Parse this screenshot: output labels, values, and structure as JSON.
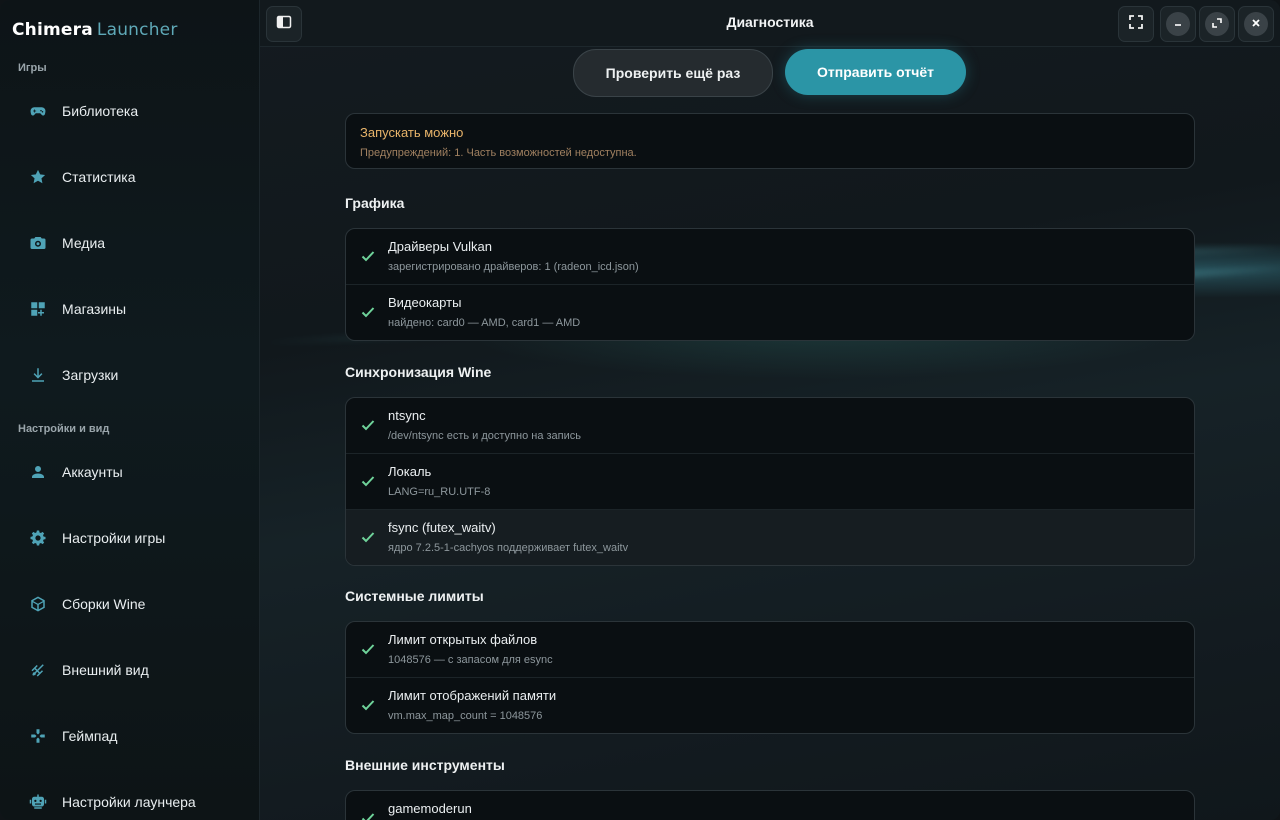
{
  "app": {
    "name_bold": "Chimera",
    "name_light": "Launcher"
  },
  "sidebar": {
    "section_games": "Игры",
    "section_settings": "Настройки и вид",
    "items": [
      {
        "label": "Библиотека",
        "icon": "gamepad-icon"
      },
      {
        "label": "Статистика",
        "icon": "star-icon"
      },
      {
        "label": "Медиа",
        "icon": "camera-icon"
      },
      {
        "label": "Магазины",
        "icon": "apps-icon"
      },
      {
        "label": "Загрузки",
        "icon": "download-icon"
      },
      {
        "label": "Аккаунты",
        "icon": "user-icon"
      },
      {
        "label": "Настройки игры",
        "icon": "gear-icon"
      },
      {
        "label": "Сборки Wine",
        "icon": "box-icon"
      },
      {
        "label": "Внешний вид",
        "icon": "palette-icon"
      },
      {
        "label": "Геймпад",
        "icon": "dpad-icon"
      },
      {
        "label": "Настройки лаунчера",
        "icon": "robot-icon"
      }
    ]
  },
  "header": {
    "title": "Диагностика"
  },
  "actions": {
    "recheck": "Проверить ещё раз",
    "send_report": "Отправить отчёт"
  },
  "status": {
    "title": "Запускать можно",
    "subtitle": "Предупреждений: 1. Часть возможностей недоступна."
  },
  "groups": [
    {
      "title": "Графика",
      "rows": [
        {
          "title": "Драйверы Vulkan",
          "subtitle": "зарегистрировано драйверов: 1 (radeon_icd.json)",
          "status": "ok"
        },
        {
          "title": "Видеокарты",
          "subtitle": "найдено: card0 — AMD, card1 — AMD",
          "status": "ok"
        }
      ]
    },
    {
      "title": "Синхронизация Wine",
      "rows": [
        {
          "title": "ntsync",
          "subtitle": "/dev/ntsync есть и доступно на запись",
          "status": "ok"
        },
        {
          "title": "Локаль",
          "subtitle": "LANG=ru_RU.UTF-8",
          "status": "ok"
        },
        {
          "title": "fsync (futex_waitv)",
          "subtitle": "ядро 7.2.5-1-cachyos поддерживает futex_waitv",
          "status": "ok"
        }
      ]
    },
    {
      "title": "Системные лимиты",
      "rows": [
        {
          "title": "Лимит открытых файлов",
          "subtitle": "1048576 — с запасом для esync",
          "status": "ok"
        },
        {
          "title": "Лимит отображений памяти",
          "subtitle": "vm.max_map_count = 1048576",
          "status": "ok"
        }
      ]
    },
    {
      "title": "Внешние инструменты",
      "rows": [
        {
          "title": "gamemoderun",
          "subtitle": "",
          "status": "ok"
        }
      ]
    }
  ],
  "colors": {
    "accent": "#2b95a6",
    "ok": "#6fd39a",
    "warn": "#e8b46a",
    "icon": "#4fa3b6"
  }
}
